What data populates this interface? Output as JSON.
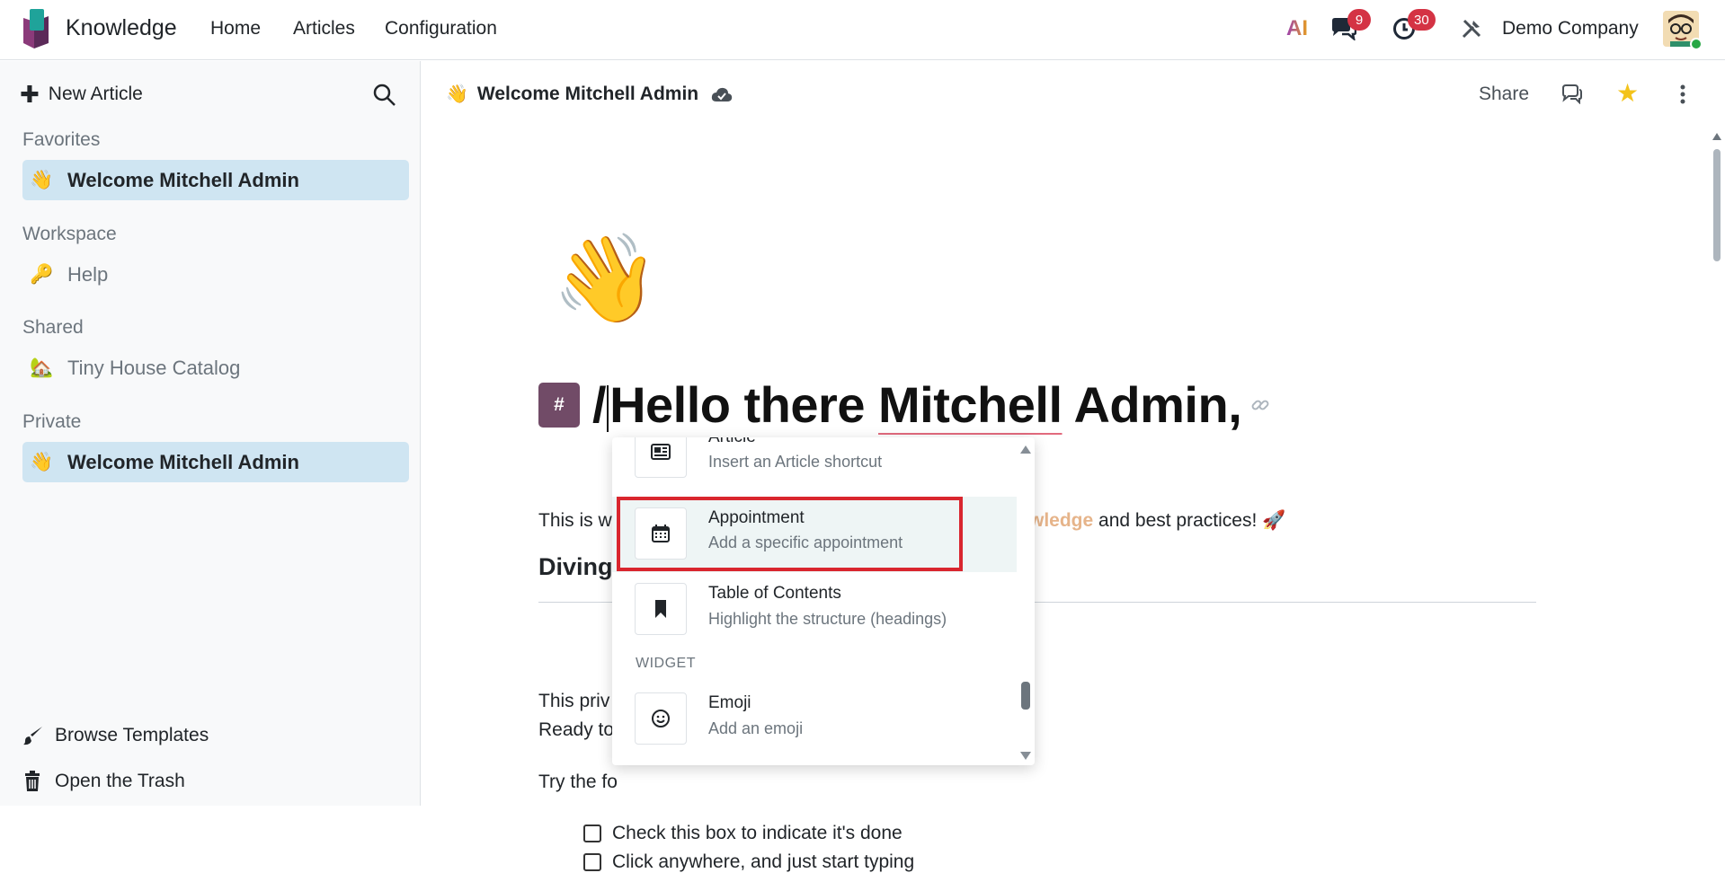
{
  "navbar": {
    "app_name": "Knowledge",
    "menu": [
      "Home",
      "Articles",
      "Configuration"
    ],
    "ai_label": "AI",
    "messages_count": "9",
    "activities_count": "30",
    "company": "Demo Company",
    "colors": {
      "brand": "#714b67",
      "badge": "#d43344"
    }
  },
  "sidebar": {
    "new_article": "New Article",
    "sections": {
      "favorites": "Favorites",
      "workspace": "Workspace",
      "shared": "Shared",
      "private": "Private"
    },
    "items": {
      "favorite": {
        "emoji": "👋",
        "label": "Welcome Mitchell Admin"
      },
      "help": {
        "emoji": "🔑",
        "label": "Help"
      },
      "catalog": {
        "emoji": "🏡",
        "label": "Tiny House Catalog"
      },
      "private": {
        "emoji": "👋",
        "label": "Welcome Mitchell Admin"
      }
    },
    "browse_templates": "Browse Templates",
    "open_trash": "Open the Trash",
    "active_color": "#cfe5f2"
  },
  "main": {
    "breadcrumb_emoji": "👋",
    "breadcrumb_title": "Welcome Mitchell Admin",
    "share": "Share",
    "cover_emoji": "👋",
    "hash": "#",
    "title_prefix": "/",
    "title_part1": "Hello there ",
    "title_part2": "Mitchell",
    "title_part3": " Admin,",
    "intro_visible_start": "This is w",
    "intro_keyword": "wledge",
    "intro_end": " and best practices! 🚀",
    "heading": "Diving",
    "p1": "This priv",
    "p2": "Ready to",
    "p3": "Try the fo",
    "check1": "Check this box to indicate it's done",
    "check2": "Click anywhere, and just start typing"
  },
  "powerbox": {
    "items": [
      {
        "name": "Article",
        "desc": "Insert an Article shortcut",
        "icon": "newspaper-icon"
      },
      {
        "name": "Appointment",
        "desc": "Add a specific appointment",
        "icon": "calendar-icon"
      },
      {
        "name": "Table of Contents",
        "desc": "Highlight the structure (headings)",
        "icon": "bookmark-icon"
      },
      {
        "name": "Emoji",
        "desc": "Add an emoji",
        "icon": "smile-icon"
      }
    ],
    "category_widget": "WIDGET",
    "highlight_color": "#d9262e"
  }
}
